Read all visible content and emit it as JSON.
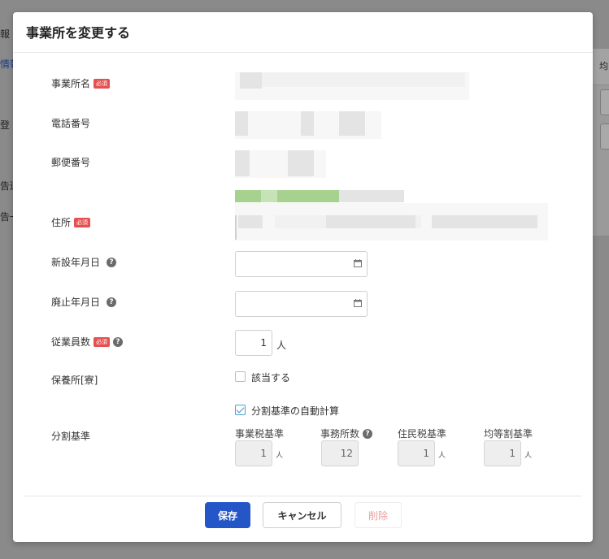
{
  "background": {
    "left_fragments": [
      "報",
      "情報",
      "登",
      "告送",
      "告一"
    ],
    "right_header": "均"
  },
  "dialog": {
    "title": "事業所を変更する",
    "required_badge": "必須",
    "fields": {
      "office_name": {
        "label": "事業所名"
      },
      "phone": {
        "label": "電話番号"
      },
      "postal_code": {
        "label": "郵便番号"
      },
      "address": {
        "label": "住所"
      },
      "established_date": {
        "label": "新設年月日",
        "value": ""
      },
      "abolished_date": {
        "label": "廃止年月日",
        "value": ""
      },
      "employees": {
        "label": "従業員数",
        "value": "1",
        "unit": "人"
      },
      "nursery": {
        "label": "保養所[寮]",
        "checkbox_label": "該当する",
        "checked": false
      },
      "split_basis": {
        "label": "分割基準",
        "auto_calc_label": "分割基準の自動計算",
        "auto_calc_checked": true,
        "items": [
          {
            "label": "事業税基準",
            "value": "1",
            "unit": "人"
          },
          {
            "label": "事務所数",
            "value": "12",
            "unit": ""
          },
          {
            "label": "住民税基準",
            "value": "1",
            "unit": "人"
          },
          {
            "label": "均等割基準",
            "value": "1",
            "unit": "人"
          }
        ]
      }
    },
    "buttons": {
      "save": "保存",
      "cancel": "キャンセル",
      "delete": "削除"
    },
    "colors": {
      "primary": "#2456c8",
      "required": "#e65050",
      "delete_text": "#e7a0a0"
    }
  }
}
